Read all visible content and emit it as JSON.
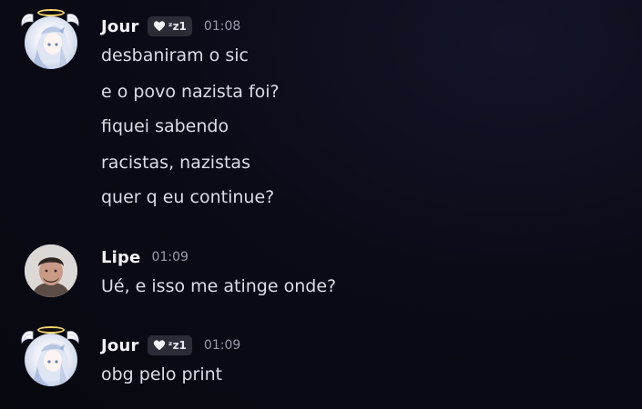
{
  "messages": [
    {
      "author": "Jour",
      "tag_text": "ᶻz1",
      "time": "01:08",
      "lines": [
        "desbaniram o sic",
        "e o povo nazista foi?",
        "fiquei sabendo",
        "racistas, nazistas",
        "quer q eu continue?"
      ]
    },
    {
      "author": "Lipe",
      "time": "01:09",
      "lines": [
        "Ué, e isso me atinge onde?"
      ]
    },
    {
      "author": "Jour",
      "tag_text": "ᶻz1",
      "time": "01:09",
      "lines": [
        "obg pelo print"
      ]
    }
  ],
  "colors": {
    "background": "#0b0b18",
    "username": "#f2f2f7",
    "message_text": "#dcdde6",
    "timestamp": "#9a9cab",
    "tag_bg": "#2b2c36",
    "halo": "#f4d56a"
  },
  "icons": {
    "tag_icon": "white-heart-icon",
    "avatar_decoration": "angel-halo-wings"
  }
}
